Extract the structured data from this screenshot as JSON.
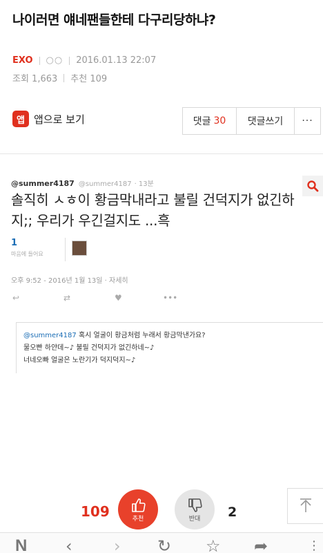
{
  "post": {
    "title": "나이러면 얘네팬들한테 다구리당하냐?",
    "category": "EXO",
    "author": "○○",
    "datetime": "2016.01.13 22:07",
    "views_label": "조회 1,663",
    "recommend_label": "추천 109"
  },
  "toolbar": {
    "app_icon": "앱",
    "app_view_label": "앱으로 보기",
    "comments_label": "댓글",
    "comments_count": "30",
    "write_comment_label": "댓글쓰기",
    "more_label": "···"
  },
  "tweet": {
    "user": "@summer4187",
    "handle": "@summer4187",
    "time_ago": "· 13분",
    "text": "솔직히 ㅅㅎ이 황금막내라고 불릴 건덕지가 없긴하지;; 우리가 우긴걸지도 ...흑",
    "fav_count": "1",
    "fav_label": "마음에 들어요",
    "date": "오후 9:52 - 2016년 1월 13일 · 자세히",
    "reply": {
      "mention": "@summer4187",
      "line1": "혹시 얼굴이 황금처럼 누래서 황금막낸가요?",
      "line2": "물오빤 하얀데~♪ 불릴 건덕지가 없긴하네~♪",
      "line3": "너네오빠 얼굴은 노란기가 덕지덕지~♪"
    }
  },
  "vote": {
    "like_count": "109",
    "like_label": "추천",
    "dislike_label": "반대",
    "dislike_count": "2"
  },
  "browser": {
    "naver_logo": "N"
  },
  "colors": {
    "accent": "#e0301e",
    "like": "#e8412b",
    "twitter_link": "#1b6db5",
    "naver": "#19b928"
  },
  "icons": [
    "search-icon",
    "reply-icon",
    "retweet-icon",
    "heart-icon",
    "more-icon",
    "thumbs-up-icon",
    "thumbs-down-icon",
    "scroll-top-icon",
    "back-icon",
    "forward-icon",
    "refresh-icon",
    "star-icon",
    "share-icon",
    "menu-icon"
  ]
}
